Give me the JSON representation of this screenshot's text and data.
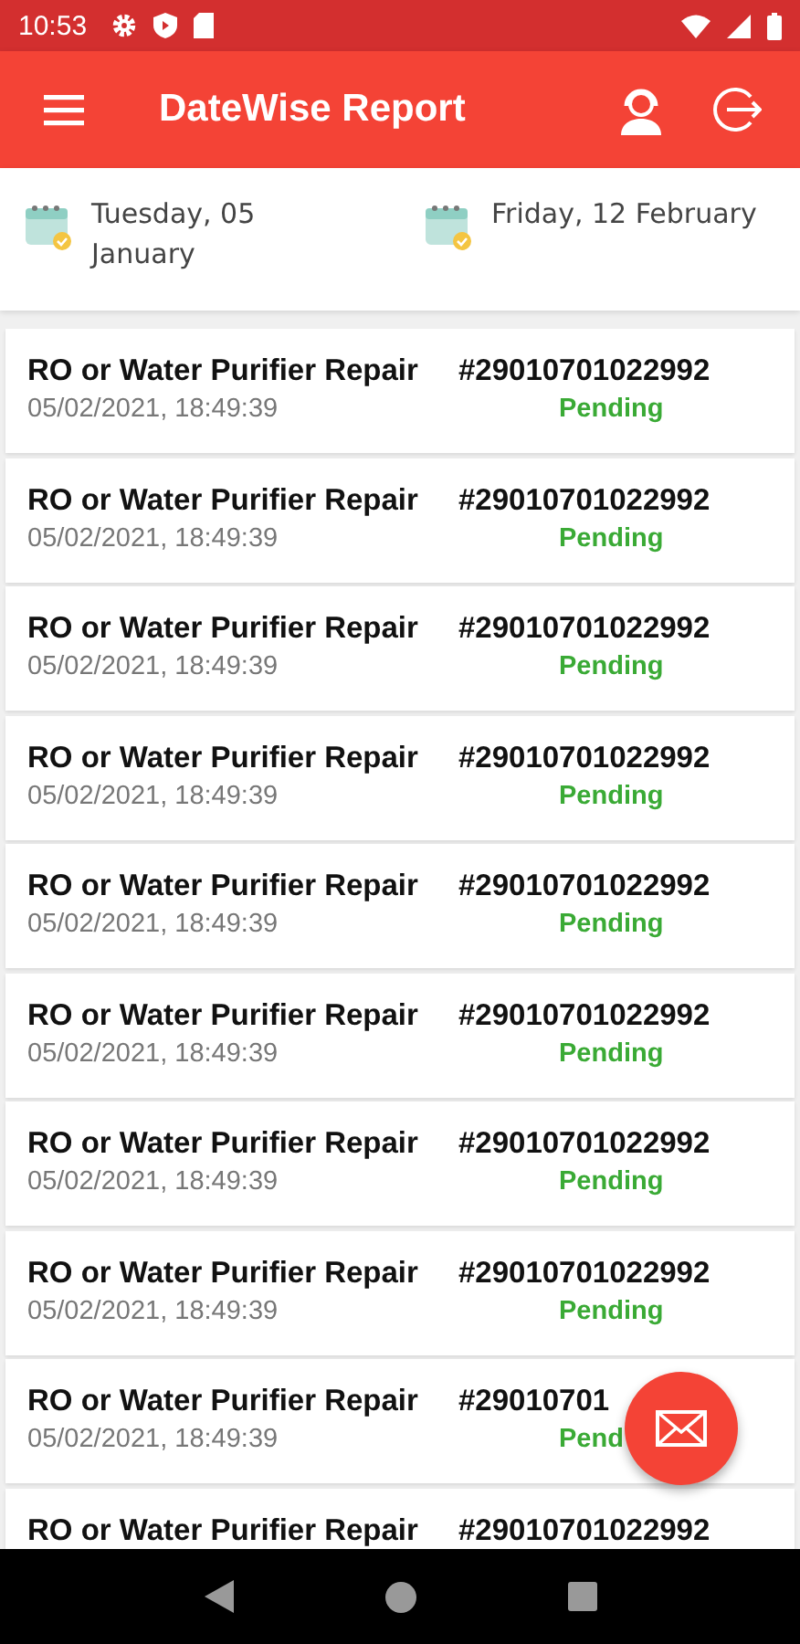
{
  "status_bar": {
    "time": "10:53"
  },
  "app_bar": {
    "title": "DateWise Report"
  },
  "date_range": [
    {
      "label": "Tuesday, 05 January"
    },
    {
      "label": "Friday, 12 February"
    }
  ],
  "orders": [
    {
      "service": "RO or Water Purifier Repair",
      "date": "05/02/2021, 18:49:39",
      "order_no": "#29010701022992",
      "status": "Pending"
    },
    {
      "service": "RO or Water Purifier Repair",
      "date": "05/02/2021, 18:49:39",
      "order_no": "#29010701022992",
      "status": "Pending"
    },
    {
      "service": "RO or Water Purifier Repair",
      "date": "05/02/2021, 18:49:39",
      "order_no": "#29010701022992",
      "status": "Pending"
    },
    {
      "service": "RO or Water Purifier Repair",
      "date": "05/02/2021, 18:49:39",
      "order_no": "#29010701022992",
      "status": "Pending"
    },
    {
      "service": "RO or Water Purifier Repair",
      "date": "05/02/2021, 18:49:39",
      "order_no": "#29010701022992",
      "status": "Pending"
    },
    {
      "service": "RO or Water Purifier Repair",
      "date": "05/02/2021, 18:49:39",
      "order_no": "#29010701022992",
      "status": "Pending"
    },
    {
      "service": "RO or Water Purifier Repair",
      "date": "05/02/2021, 18:49:39",
      "order_no": "#29010701022992",
      "status": "Pending"
    },
    {
      "service": "RO or Water Purifier Repair",
      "date": "05/02/2021, 18:49:39",
      "order_no": "#29010701022992",
      "status": "Pending"
    },
    {
      "service": "RO or Water Purifier Repair",
      "date": "05/02/2021, 18:49:39",
      "order_no": "#29010701",
      "status": "Pend"
    },
    {
      "service": "RO or Water Purifier Repair",
      "order_no": "#29010701022992"
    }
  ]
}
